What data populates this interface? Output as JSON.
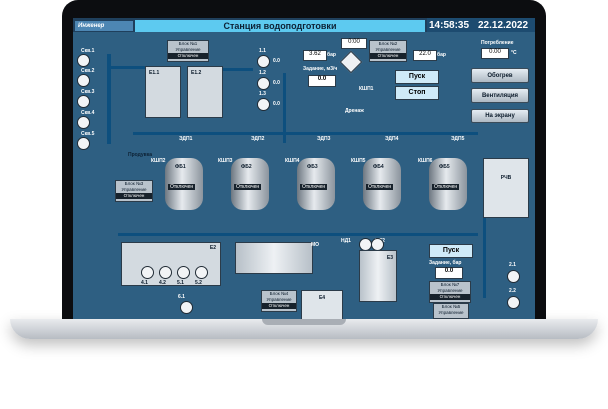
{
  "header": {
    "badge": "Инженер",
    "title": "Станция водоподготовки",
    "time": "14:58:35",
    "date": "22.12.2022"
  },
  "top": {
    "blocks": [
      {
        "title": "Блок №1",
        "mode": "Управление",
        "state": "Отключен"
      },
      {
        "title": "Блок №2",
        "mode": "Управление",
        "state": "Отключен"
      }
    ],
    "counter": "0:00",
    "flow": "3.62",
    "flow_unit": "бар",
    "pressure2": "22.0",
    "pressure2_unit": "бар",
    "setpoint_label": "Задание, м3/ч",
    "setpoint_value": "0.0",
    "valve_label": "КШП1",
    "drain_label": "Дренаж",
    "start_label": "Пуск",
    "stop_label": "Стоп"
  },
  "right_panel": {
    "consumption_label": "Потребление",
    "consumption_value": "0.00",
    "consumption_unit": "°С",
    "heating_label": "Обогрев",
    "ventilation_label": "Вентиляция",
    "to_screen_label": "На экрану"
  },
  "wells": [
    "Скв.1",
    "Скв.2",
    "Скв.3",
    "Скв.4",
    "Скв.5"
  ],
  "filters": [
    "Е1.1",
    "Е1.2"
  ],
  "pumps_upper": [
    {
      "name": "1.1",
      "value": "0.0",
      "unit": "бар"
    },
    {
      "name": "1.2",
      "value": "0.0",
      "unit": "бар"
    },
    {
      "name": "1.3",
      "value": "0.0",
      "unit": "бар"
    }
  ],
  "valves": [
    "ЭДП1",
    "ЭДП2",
    "ЭДП3",
    "ЭДП4",
    "ЭДП5"
  ],
  "ball_valves": [
    "КШП2",
    "КШП3",
    "КШП4",
    "КШП5",
    "КШП6"
  ],
  "tanks": [
    {
      "name": "ФБ1",
      "state": "Отключен"
    },
    {
      "name": "ФБ2",
      "state": "Отключен"
    },
    {
      "name": "ФБ3",
      "state": "Отключен"
    },
    {
      "name": "ФБ4",
      "state": "Отключен"
    },
    {
      "name": "ФБ5",
      "state": "Отключен"
    }
  ],
  "purge_label": "Продувка",
  "block3": {
    "title": "Блок №3",
    "mode": "Управление",
    "state": "Отключен"
  },
  "rchv": "РЧВ",
  "lower": {
    "e2": "Е2",
    "pumps": [
      "4.1",
      "4.2",
      "5.1",
      "5.2"
    ],
    "mo": "МО",
    "e3": "Е3",
    "e4": "Е4",
    "nd1": "НД1",
    "nd2": "НД2",
    "pump61": "6.1",
    "block4": {
      "title": "Блок №4",
      "mode": "Управление",
      "state": "Отключен"
    },
    "start_label": "Пуск",
    "setpoint_label": "Задание, бар",
    "setpoint_value": "0.0",
    "block7": {
      "title": "Блок №7",
      "mode": "Управление",
      "state": "Отключен"
    },
    "block5": {
      "title": "Блок №5",
      "mode": "Управление"
    },
    "right_pumps": [
      "2.1",
      "2.2"
    ]
  },
  "colors": {
    "screen_bg": "#2e5f82",
    "header_bg": "#1f3f5c",
    "title_bar": "#5dcaf0",
    "pipe": "#0d4f7e",
    "accent_value": "#0d2235"
  }
}
